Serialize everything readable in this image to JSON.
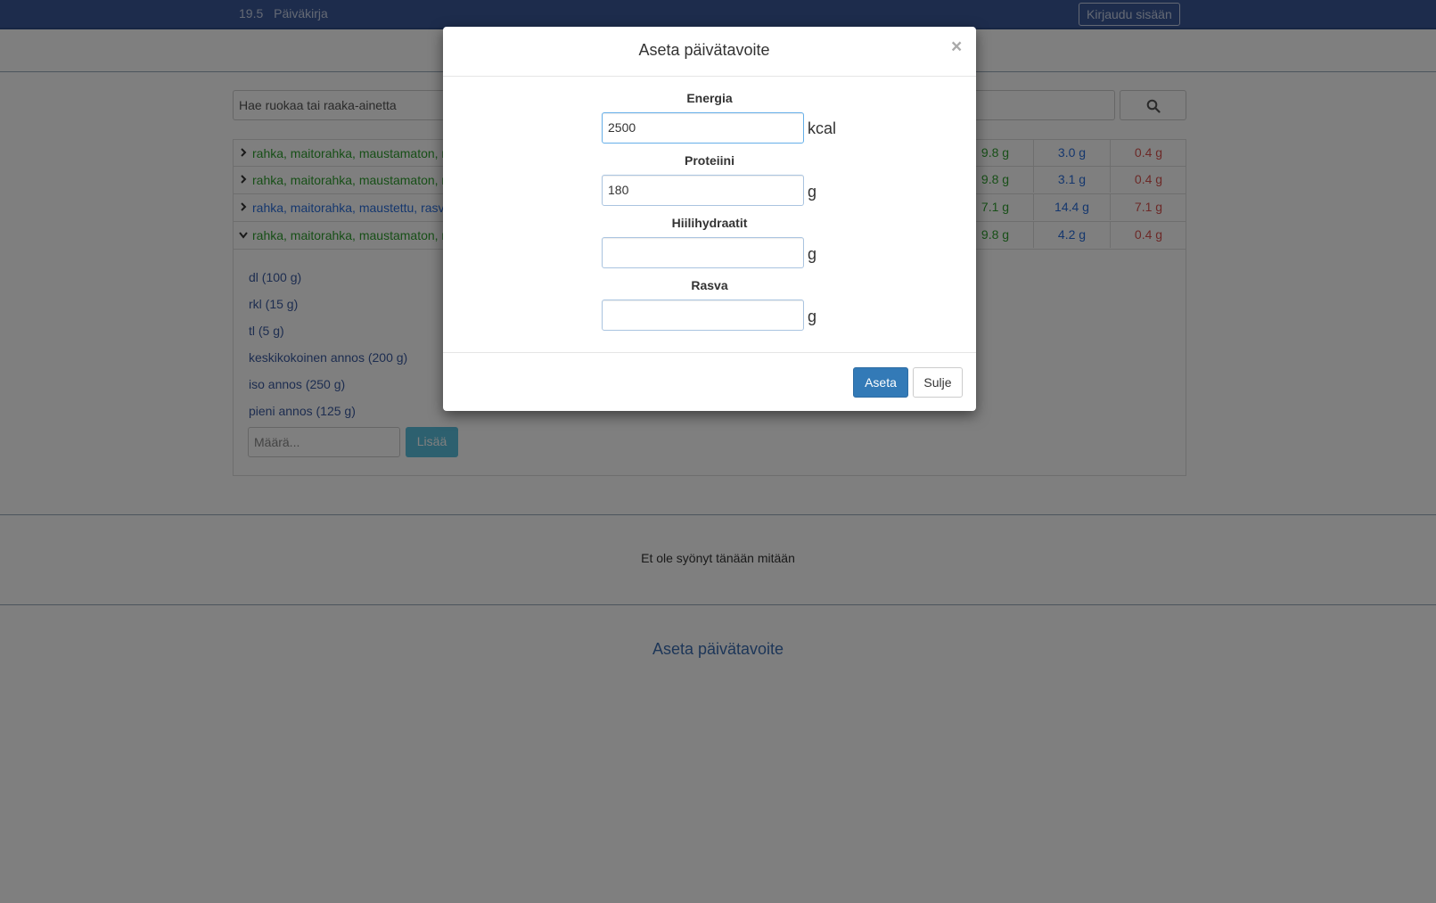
{
  "navbar": {
    "date": "19.5",
    "title": "Päiväkirja",
    "login_label": "Kirjaudu sisään"
  },
  "search": {
    "placeholder": "Hae ruokaa tai raaka-ainetta",
    "button_icon": "search-icon"
  },
  "results": [
    {
      "name": "rahka, maitorahka, maustamaton, r",
      "protein": "9.8 g",
      "carbs": "3.0 g",
      "fat": "0.4 g",
      "name_color": "green",
      "expanded": false
    },
    {
      "name": "rahka, maitorahka, maustamaton, r",
      "protein": "9.8 g",
      "carbs": "3.1 g",
      "fat": "0.4 g",
      "name_color": "green",
      "expanded": false
    },
    {
      "name": "rahka, maitorahka, maustettu, rasv",
      "protein": "7.1 g",
      "carbs": "14.4 g",
      "fat": "7.1 g",
      "name_color": "blue",
      "expanded": false
    },
    {
      "name": "rahka, maitorahka, maustamaton, r",
      "protein": "9.8 g",
      "carbs": "4.2 g",
      "fat": "0.4 g",
      "name_color": "green",
      "expanded": true
    }
  ],
  "portions": [
    "dl (100 g)",
    "rkl (15 g)",
    "tl (5 g)",
    "keskikokoinen annos (200 g)",
    "iso annos (250 g)",
    "pieni annos (125 g)"
  ],
  "amount": {
    "placeholder": "Määrä...",
    "add_label": "Lisää"
  },
  "diary": {
    "empty_message": "Et ole syönyt tänään mitään",
    "set_goal_link": "Aseta päivätavoite"
  },
  "modal": {
    "title": "Aseta päivätavoite",
    "close_icon": "×",
    "fields": [
      {
        "label": "Energia",
        "value": "2500",
        "unit": "kcal"
      },
      {
        "label": "Proteiini",
        "value": "180",
        "unit": "g"
      },
      {
        "label": "Hiilihydraatit",
        "value": "",
        "unit": "g"
      },
      {
        "label": "Rasva",
        "value": "",
        "unit": "g"
      }
    ],
    "submit_label": "Aseta",
    "close_label": "Sulje"
  },
  "colors": {
    "navbar": "#3b5998",
    "primary": "#337ab7",
    "info": "#5bc0de",
    "protein": "#2e9e2e",
    "carbs": "#2a6fdc",
    "fat": "#d9534f"
  }
}
